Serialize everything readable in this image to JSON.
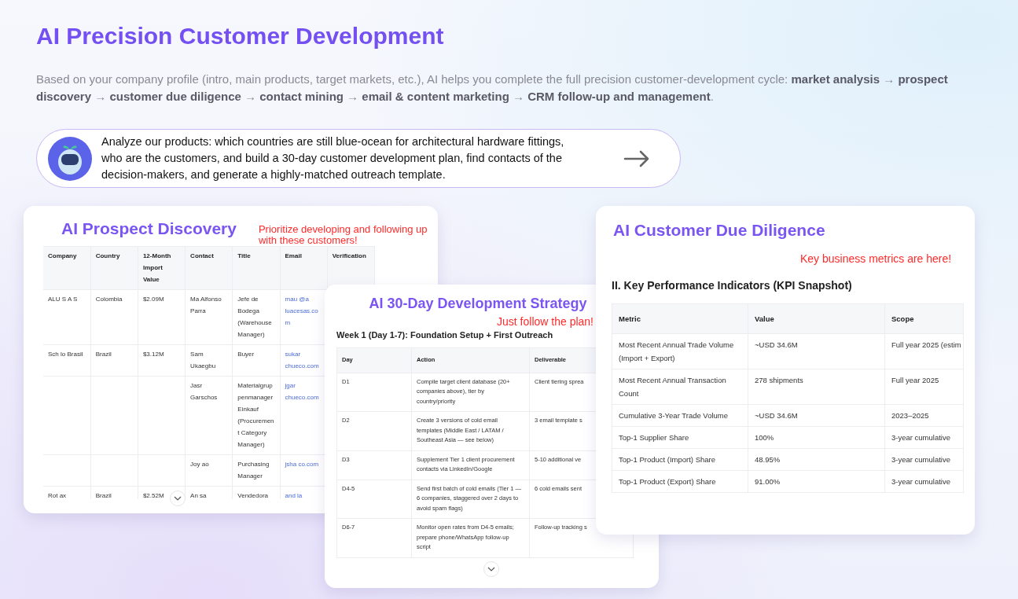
{
  "title": "AI Precision Customer Development",
  "intro": "Based on your company profile (intro, main products, target markets, etc.), AI helps you complete the full precision customer-development cycle: **market analysis** → **prospect discovery** → **customer due diligence** → **contact mining** → **email & content marketing** → **CRM follow-up and management**.",
  "prompt": {
    "text": "Analyze our products: which countries are still blue-ocean for architectural hardware fittings, who are the customers, and build a 30-day customer development plan, find contacts of the decision-makers, and generate a highly-matched outreach template."
  },
  "cards": [
    {
      "kind": "prospects",
      "title": "AI Prospect Discovery",
      "note": "Prioritize developing and following up with these customers!",
      "has_scroll_button": true,
      "table": {
        "columns": [
          "Company",
          "Country",
          "12-Month Import Value",
          "Contact",
          "Title",
          "Email",
          "Verification"
        ],
        "rows": [
          [
            "ALU S A S",
            "Colombia",
            "$2.09M",
            "Ma Alfonso Parra",
            "Jefe de Bodega (Warehouse Manager)",
            "mau @a luacesas.com"
          ],
          [
            "Sch lo Brasil",
            "Brazil",
            "$3.12M",
            "Sam Ukaegbu",
            "Buyer",
            "sukar chueco.com"
          ],
          [
            null,
            null,
            null,
            "Jasr Garschos",
            "Materialgruppenmanager Einkauf (Procurement Category Manager)",
            "jgar chueco.com"
          ],
          [
            null,
            null,
            null,
            "Joy ao",
            "Purchasing Manager",
            "jsha co.com"
          ],
          [
            "Rot ax",
            "Brazil",
            "$2.52M",
            "An sa",
            "Vendedora",
            "and la"
          ]
        ]
      }
    },
    {
      "kind": "strategy",
      "title": "AI 30-Day Development Strategy",
      "note": "Just follow the plan!",
      "subtitle": "Week 1 (Day 1-7): Foundation Setup + First Outreach",
      "has_scroll_button": true,
      "table": {
        "columns": [
          "Day",
          "Action",
          "Deliverable"
        ],
        "rows": [
          [
            "D1",
            "Compile target client database (20+ companies above), tier by country/priority",
            "Client tiering sprea"
          ],
          [
            "D2",
            "Create 3 versions of cold email templates (Middle East / LATAM / Southeast Asia — see below)",
            "3 email template s"
          ],
          [
            "D3",
            "Supplement Tier 1 client procurement contacts via LinkedIn/Google",
            "5-10 additional ve"
          ],
          [
            "D4-5",
            "Send first batch of cold emails (Tier 1 — 6 companies, staggered over 2 days to avoid spam flags)",
            "6 cold emails sent"
          ],
          [
            "D6-7",
            "Monitor open rates from D4-5 emails; prepare phone/WhatsApp follow-up script",
            "Follow-up tracking s"
          ]
        ]
      }
    },
    {
      "kind": "kpi",
      "title": "AI Customer Due Diligence",
      "note": "Key business metrics are here!",
      "subtitle": "II. Key Performance Indicators (KPI Snapshot)",
      "has_scroll_button": false,
      "table": {
        "columns": [
          "Metric",
          "Value",
          "Scope"
        ],
        "rows": [
          [
            "Most Recent Annual Trade Volume (Import + Export)",
            "~USD 34.6M",
            "Full year 2025 (estim"
          ],
          [
            "Most Recent Annual Transaction Count",
            "278 shipments",
            "Full year 2025"
          ],
          [
            "Cumulative 3-Year Trade Volume",
            "~USD 34.6M",
            "2023–2025"
          ],
          [
            "Top-1 Supplier Share",
            "100%",
            "3-year cumulative"
          ],
          [
            "Top-1 Product (Import) Share",
            "48.95%",
            "3-year cumulative"
          ],
          [
            "Top-1 Product (Export) Share",
            "91.00%",
            "3-year cumulative"
          ]
        ]
      }
    }
  ]
}
